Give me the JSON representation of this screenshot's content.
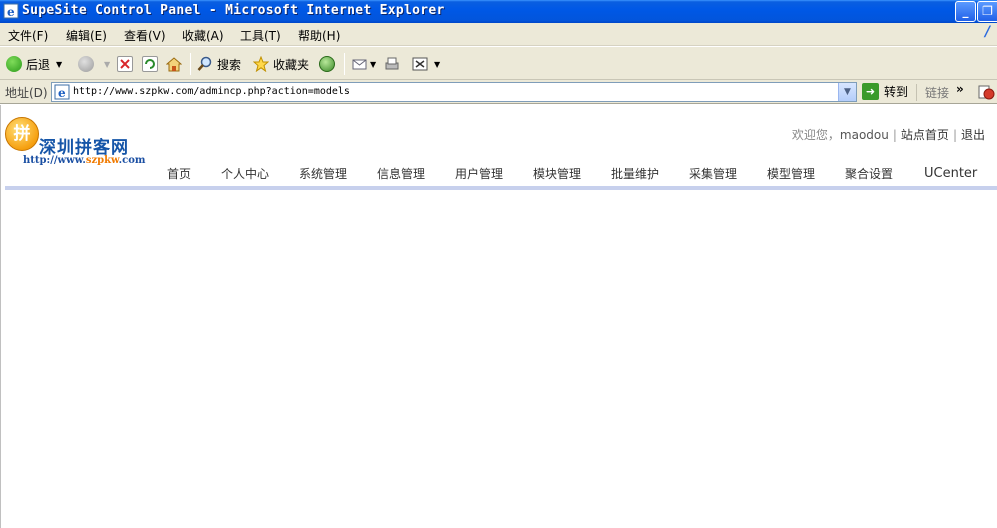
{
  "window": {
    "title": "SupeSite Control Panel - Microsoft Internet Explorer",
    "minimize_label": "_",
    "maximize_label": "❐"
  },
  "menu": {
    "items": [
      {
        "label": "文件(F)"
      },
      {
        "label": "编辑(E)"
      },
      {
        "label": "查看(V)"
      },
      {
        "label": "收藏(A)"
      },
      {
        "label": "工具(T)"
      },
      {
        "label": "帮助(H)"
      }
    ]
  },
  "toolbar": {
    "back_label": "后退",
    "search_label": "搜索",
    "favorites_label": "收藏夹"
  },
  "address": {
    "label": "地址(D)",
    "url": "http://www.szpkw.com/admincp.php?action=models",
    "go_label": "转到",
    "links_label": "链接"
  },
  "site": {
    "logo_char": "拼",
    "logo_name": "深圳拼客网",
    "logo_url_prefix": "http://www.",
    "logo_url_highlight": "szpkw",
    "logo_url_suffix": ".com"
  },
  "userbar": {
    "welcome": "欢迎您，",
    "username": "maodou",
    "home_link": "站点首页",
    "logout_link": "退出"
  },
  "nav": {
    "items": [
      {
        "label": "首页"
      },
      {
        "label": "个人中心"
      },
      {
        "label": "系统管理"
      },
      {
        "label": "信息管理"
      },
      {
        "label": "用户管理"
      },
      {
        "label": "模块管理"
      },
      {
        "label": "批量维护"
      },
      {
        "label": "采集管理"
      },
      {
        "label": "模型管理"
      },
      {
        "label": "聚合设置"
      },
      {
        "label": "UCenter"
      }
    ]
  },
  "colors": {
    "titlebar": "#0058e6",
    "chrome": "#ece9d8",
    "nav_underline": "#c7d0ed",
    "logo_blue": "#1555a8",
    "logo_orange": "#f07a00"
  }
}
